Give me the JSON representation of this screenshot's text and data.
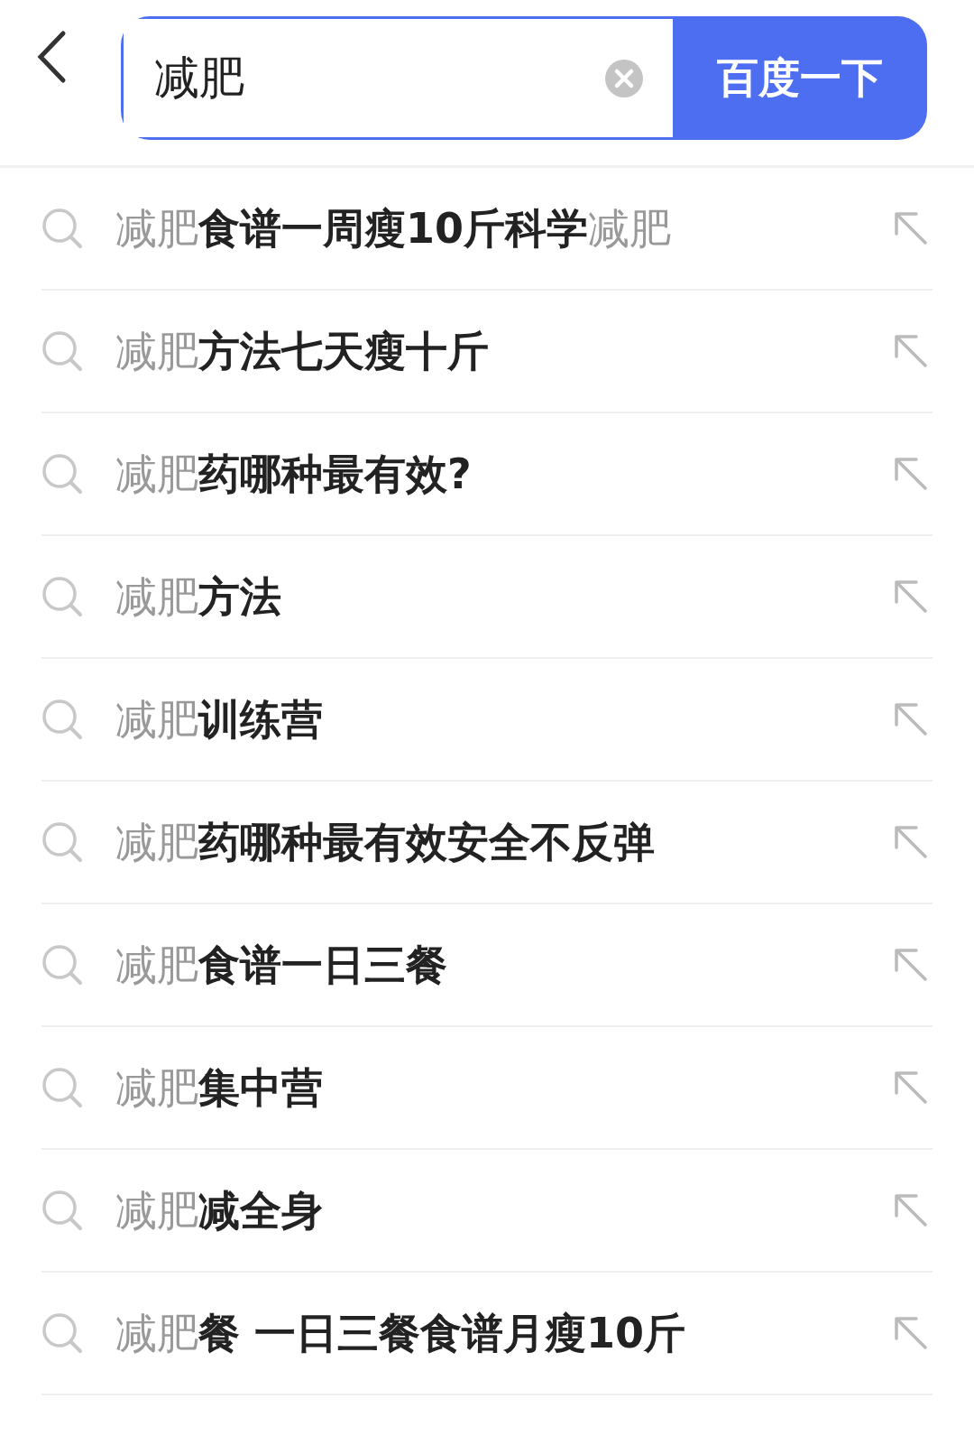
{
  "search": {
    "value": "减肥",
    "button": "百度一下"
  },
  "suggestions": [
    {
      "text": "减肥**食谱一周瘦10斤科学**减肥"
    },
    {
      "text": "减肥**方法七天瘦十斤**"
    },
    {
      "text": "减肥**药哪种最有效?**"
    },
    {
      "text": "减肥**方法**"
    },
    {
      "text": "减肥**训练营**"
    },
    {
      "text": "减肥**药哪种最有效安全不反弹**"
    },
    {
      "text": "减肥**食谱一日三餐**"
    },
    {
      "text": "减肥**集中营**"
    },
    {
      "text": "减肥**减全身**"
    },
    {
      "text": "减肥**餐 一日三餐食谱月瘦10斤**"
    }
  ]
}
